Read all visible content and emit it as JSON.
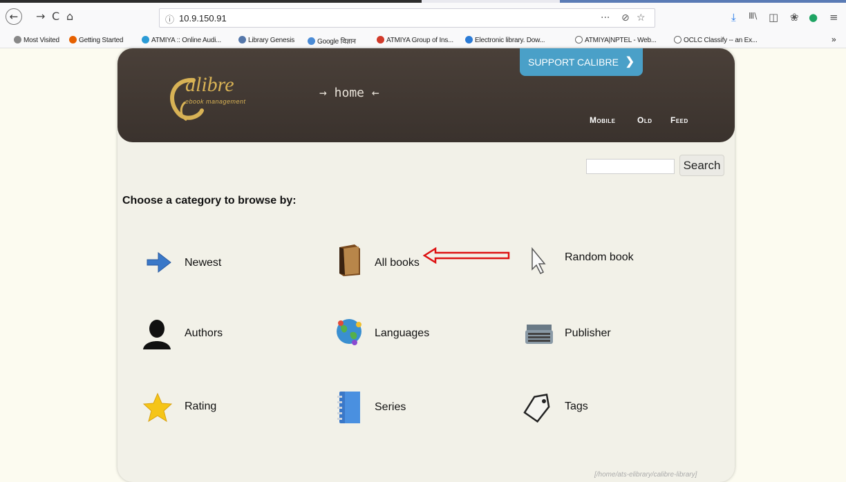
{
  "browser": {
    "url": "10.9.150.91",
    "nav": {
      "back": "←",
      "forward": "→",
      "reload": "C",
      "home": "⌂"
    },
    "url_icons": {
      "more": "···",
      "pocket": "⊘",
      "star": "☆"
    },
    "toolbar_icons": {
      "download": "⤓",
      "library": "Ⅲ\\",
      "sidebar": "◫",
      "ext": "❀",
      "ext2": "●",
      "menu": "≡"
    },
    "bookmarks_overflow": "»",
    "bookmarks": [
      {
        "label": "Most Visited",
        "color": "#888888"
      },
      {
        "label": "Getting Started",
        "color": "#e66000"
      },
      {
        "label": "ATMIYA :: Online Audi...",
        "color": "#2b9bd6"
      },
      {
        "label": "Library Genesis",
        "color": "#5577aa"
      },
      {
        "label": "Google विज्ञान",
        "color": "#4a8bd6"
      },
      {
        "label": "ATMIYA Group of Ins...",
        "color": "#d23a2a"
      },
      {
        "label": "Electronic library. Dow...",
        "color": "#2b7bd6"
      },
      {
        "label": "ATMIYA|NPTEL - Web...",
        "color": "#777777"
      },
      {
        "label": "OCLC Classify -- an Ex...",
        "color": "#777777"
      }
    ]
  },
  "header": {
    "logo_text": "alibre",
    "logo_sub": "ebook management",
    "support_label": "SUPPORT CALIBRE",
    "support_chevron": "❯",
    "home_text": "→ home ←",
    "links": {
      "mobile": "Mobile",
      "old": "Old",
      "feed": "Feed"
    }
  },
  "search": {
    "button": "Search",
    "value": ""
  },
  "choose_label": "Choose a category to browse by:",
  "categories": [
    {
      "label": "Newest",
      "icon": "arrow-right-icon"
    },
    {
      "label": "All books",
      "icon": "book-icon"
    },
    {
      "label": "Random book",
      "icon": "cursor-icon"
    },
    {
      "label": "Authors",
      "icon": "person-icon"
    },
    {
      "label": "Languages",
      "icon": "globe-icon"
    },
    {
      "label": "Publisher",
      "icon": "typewriter-icon"
    },
    {
      "label": "Rating",
      "icon": "star-icon"
    },
    {
      "label": "Series",
      "icon": "notebook-icon"
    },
    {
      "label": "Tags",
      "icon": "tag-icon"
    }
  ],
  "footer_path": "[/home/ats-elibrary/calibre-library]",
  "colors": {
    "header": "#3e3530",
    "accent": "#4aa0c8",
    "annotation": "#dd1111",
    "card": "#f2f1e8"
  }
}
